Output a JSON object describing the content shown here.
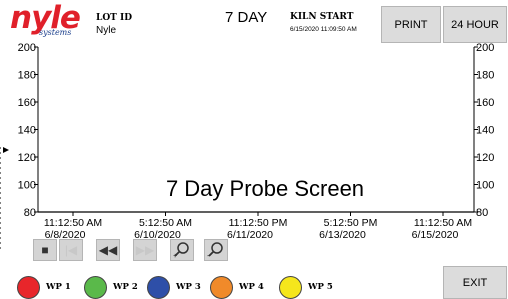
{
  "header": {
    "logo_text": "nyle",
    "logo_subtext": "systems",
    "lot_label": "LOT ID",
    "lot_value": "Nyle",
    "title": "7 DAY",
    "kiln_start_label": "KILN START",
    "kiln_start_value": "6/15/2020 11:09:50 AM",
    "print_label": "PRINT",
    "range_label": "24 HOUR"
  },
  "chart_data": {
    "type": "line",
    "title": "7 Day Probe Screen",
    "ylim": [
      80,
      200
    ],
    "y_ticks": [
      "200",
      "180",
      "160",
      "140",
      "120",
      "100",
      "80"
    ],
    "x_ticks": [
      {
        "time": "11:12:50 AM",
        "date": "6/8/2020"
      },
      {
        "time": "5:12:50 AM",
        "date": "6/10/2020"
      },
      {
        "time": "11:12:50 PM",
        "date": "6/11/2020"
      },
      {
        "time": "5:12:50 PM",
        "date": "6/13/2020"
      },
      {
        "time": "11:12:50 AM",
        "date": "6/15/2020"
      }
    ],
    "series": [],
    "grid": false
  },
  "controls": {
    "stop_icon": "stop-icon",
    "first_icon": "skip-to-start-icon",
    "rewind_icon": "rewind-icon",
    "forward_icon": "fast-forward-icon",
    "zoom_in_icon": "zoom-in-icon",
    "zoom_out_icon": "zoom-out-icon"
  },
  "legend": [
    {
      "label": "WP 1",
      "color": "#e8262b"
    },
    {
      "label": "WP 2",
      "color": "#5ab94a"
    },
    {
      "label": "WP 3",
      "color": "#2e4fa8"
    },
    {
      "label": "WP 4",
      "color": "#f08a2a"
    },
    {
      "label": "WP 5",
      "color": "#f5e61c"
    }
  ],
  "footer": {
    "exit_label": "EXIT"
  }
}
